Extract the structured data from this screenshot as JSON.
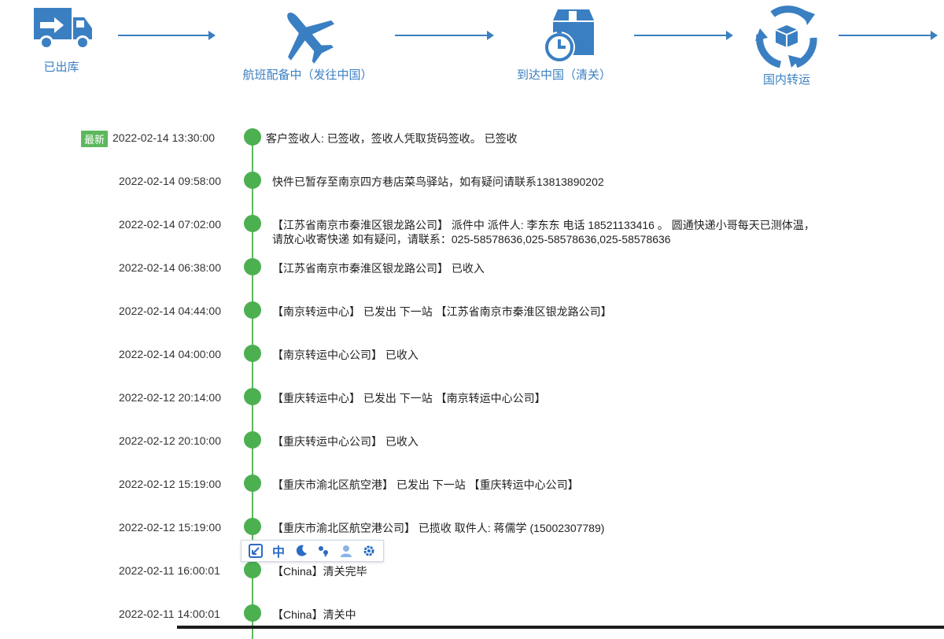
{
  "steps": [
    {
      "label": "已出库",
      "icon": "truck-icon"
    },
    {
      "label": "航班配备中（发往中国）",
      "icon": "airplane-icon"
    },
    {
      "label": "到达中国（清关）",
      "icon": "package-stopwatch-icon"
    },
    {
      "label": "国内转运",
      "icon": "cycle-box-icon"
    }
  ],
  "latest_badge": "最新",
  "events": [
    {
      "time": "2022-02-14 13:30:00",
      "lines": [
        "客户签收人: 已签收，签收人凭取货码签收。 已签收"
      ]
    },
    {
      "time": "2022-02-14 09:58:00",
      "lines": [
        "快件已暂存至南京四方巷店菜鸟驿站，如有疑问请联系13813890202"
      ]
    },
    {
      "time": "2022-02-14 07:02:00",
      "lines": [
        "【江苏省南京市秦淮区银龙路公司】 派件中 派件人: 李东东 电话 18521133416 。 圆通快递小哥每天已测体温，",
        "请放心收寄快递 如有疑问，请联系：025-58578636,025-58578636,025-58578636"
      ]
    },
    {
      "time": "2022-02-14 06:38:00",
      "lines": [
        "【江苏省南京市秦淮区银龙路公司】 已收入"
      ]
    },
    {
      "time": "2022-02-14 04:44:00",
      "lines": [
        "【南京转运中心】 已发出 下一站 【江苏省南京市秦淮区银龙路公司】"
      ]
    },
    {
      "time": "2022-02-14 04:00:00",
      "lines": [
        "【南京转运中心公司】 已收入"
      ]
    },
    {
      "time": "2022-02-12 20:14:00",
      "lines": [
        "【重庆转运中心】 已发出 下一站 【南京转运中心公司】"
      ]
    },
    {
      "time": "2022-02-12 20:10:00",
      "lines": [
        "【重庆转运中心公司】 已收入"
      ]
    },
    {
      "time": "2022-02-12 15:19:00",
      "lines": [
        "【重庆市渝北区航空港】 已发出 下一站 【重庆转运中心公司】"
      ]
    },
    {
      "time": "2022-02-12 15:19:00",
      "lines": [
        "【重庆市渝北区航空港公司】 已揽收 取件人: 蒋儒学 (15002307789)"
      ]
    },
    {
      "time": "2022-02-11 16:00:01",
      "lines": [
        "【China】清关完毕"
      ]
    },
    {
      "time": "2022-02-11 14:00:01",
      "lines": [
        "【China】清关中"
      ]
    }
  ],
  "ime_toolbar": {
    "mode_label": "中",
    "buttons": [
      "ime-switch-icon",
      "chinese-mode",
      "moon-icon",
      "punctuation-icon",
      "user-icon",
      "gear-icon"
    ]
  },
  "colors": {
    "accent": "#3a7fc2",
    "timeline_green": "#4caf50",
    "badge_green": "#5cb85c",
    "ime_blue": "#2b6cc4"
  }
}
